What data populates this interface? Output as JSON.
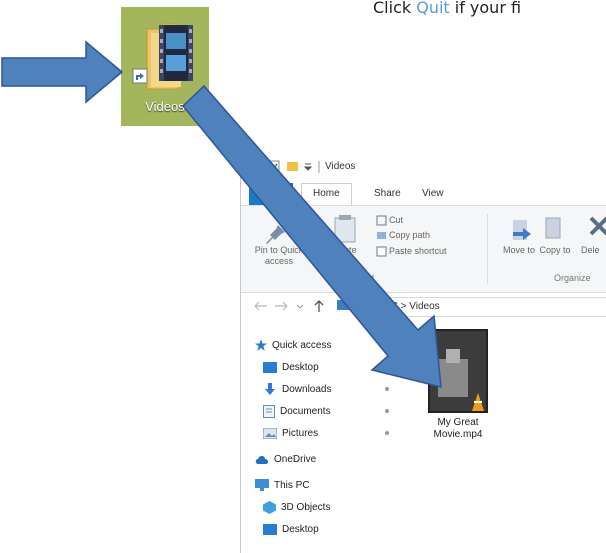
{
  "instruction": {
    "prefix": "Click ",
    "link": "Quit",
    "suffix": " if your fi"
  },
  "desktop_shortcut": {
    "label": "Videos"
  },
  "explorer": {
    "title": "Videos",
    "tabs": [
      "Home",
      "Share",
      "View"
    ],
    "ribbon": {
      "pin_label": "Pin to Quick access",
      "paste": "Paste",
      "cut": "Cut",
      "copy_path": "Copy path",
      "paste_shortcut": "Paste shortcut",
      "clipboard_group_partial": "ard",
      "move_to": "Move to",
      "copy_to": "Copy to",
      "delete_partial": "Dele",
      "organize_group": "Organize"
    },
    "address": "PC  >  Videos",
    "nav_items": [
      "Quick access",
      "Desktop",
      "Downloads",
      "Documents",
      "Pictures",
      "OneDrive",
      "This PC",
      "3D Objects",
      "Desktop"
    ],
    "file": {
      "name_line1": "My Great",
      "name_line2": "Movie.mp4"
    }
  },
  "colors": {
    "arrow_fill": "#4f81bd",
    "arrow_stroke": "#2f5597",
    "shortcut_bg": "#a3b65c",
    "file_tab": "#1979ca",
    "link": "#5b9bd5"
  }
}
